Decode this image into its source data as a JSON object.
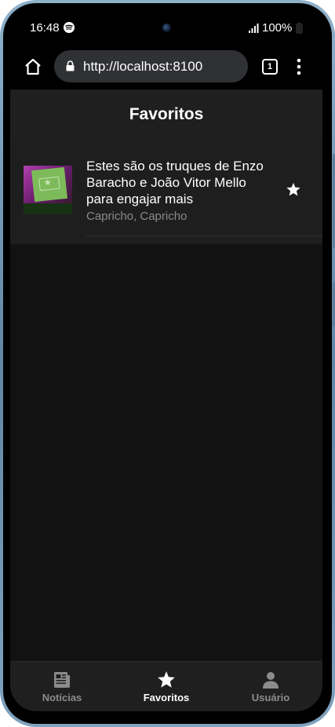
{
  "status_bar": {
    "time": "16:48",
    "battery": "100%"
  },
  "browser": {
    "url": "http://localhost:8100",
    "tab_count": "1"
  },
  "header": {
    "title": "Favoritos"
  },
  "favorites": [
    {
      "title": "Estes são os truques de Enzo Baracho e João Vitor Mello para engajar mais",
      "source": "Capricho, Capricho",
      "favorited": true
    }
  ],
  "tabs": [
    {
      "label": "Notícias",
      "icon": "newspaper-icon",
      "active": false
    },
    {
      "label": "Favoritos",
      "icon": "star-icon",
      "active": true
    },
    {
      "label": "Usuário",
      "icon": "person-icon",
      "active": false
    }
  ],
  "colors": {
    "background": "#121212",
    "toolbar": "#1f1f1f",
    "item": "#1e1e1e",
    "inactive_tab": "#8c8c8c",
    "active_tab": "#ffffff"
  }
}
